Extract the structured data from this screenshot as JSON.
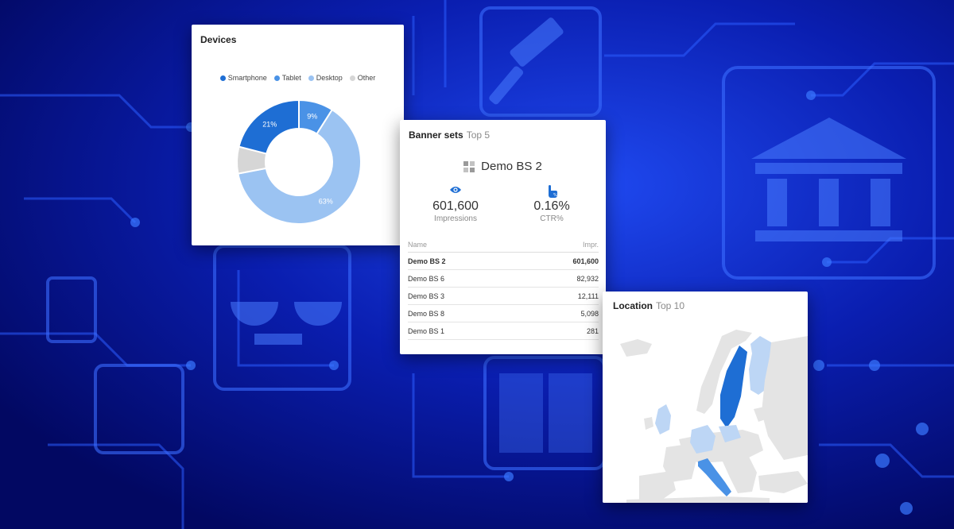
{
  "devices": {
    "title": "Devices",
    "legend": [
      {
        "label": "Smartphone",
        "color": "#1e6ed4"
      },
      {
        "label": "Tablet",
        "color": "#4a92e6"
      },
      {
        "label": "Desktop",
        "color": "#9bc3f2"
      },
      {
        "label": "Other",
        "color": "#d6d6d6"
      }
    ],
    "slice_labels": [
      "21%",
      "9%",
      "63%"
    ]
  },
  "chart_data": {
    "type": "pie",
    "categories": [
      "Smartphone",
      "Tablet",
      "Desktop",
      "Other"
    ],
    "values": [
      21,
      9,
      63,
      7
    ],
    "title": "Devices",
    "donut": true,
    "colors": [
      "#1e6ed4",
      "#4a92e6",
      "#9bc3f2",
      "#d6d6d6"
    ],
    "legend": "top"
  },
  "banners": {
    "title": "Banner sets",
    "subtitle": "Top 5",
    "featured_name": "Demo BS 2",
    "impressions_value": "601,600",
    "impressions_label": "Impressions",
    "ctr_value": "0.16%",
    "ctr_label": "CTR%",
    "columns": [
      "Name",
      "Impr."
    ],
    "rows": [
      {
        "name": "Demo BS 2",
        "impr": "601,600"
      },
      {
        "name": "Demo BS 6",
        "impr": "82,932"
      },
      {
        "name": "Demo BS 3",
        "impr": "12,111"
      },
      {
        "name": "Demo BS 8",
        "impr": "5,098"
      },
      {
        "name": "Demo BS 1",
        "impr": "281"
      }
    ]
  },
  "location": {
    "title": "Location",
    "subtitle": "Top 10",
    "highlight_strong": "#1e6ed4",
    "highlight_light": "#bdd6f5",
    "land_color": "#e4e4e4"
  }
}
